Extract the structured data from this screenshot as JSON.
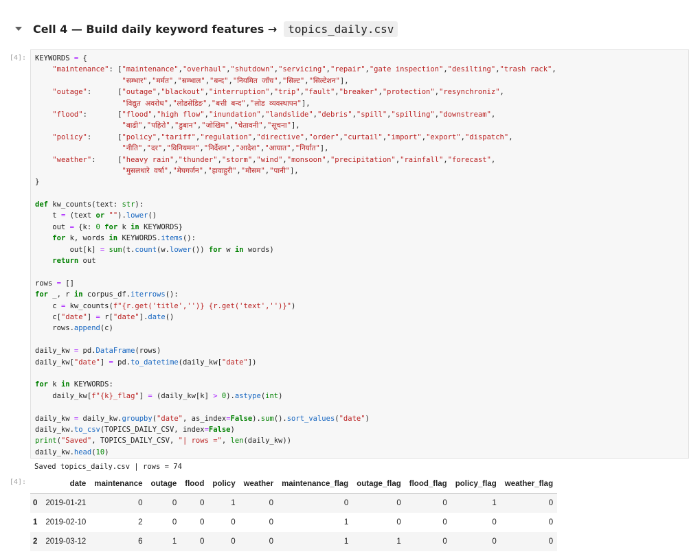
{
  "cell_heading": {
    "text": "Cell 4 — Build daily keyword features →",
    "code": "topics_daily.csv"
  },
  "code_prompt": "[4]:",
  "code_lines": [
    "KEYWORDS = {",
    "    \"maintenance\": [\"maintenance\",\"overhaul\",\"shutdown\",\"servicing\",\"repair\",\"gate inspection\",\"desilting\",\"trash rack\",",
    "                    \"सम्भार\",\"मर्मत\",\"सम्भाल\",\"बन्द\",\"नियमित जाँच\",\"सिल्ट\",\"सिल्टेशन\"],",
    "    \"outage\":      [\"outage\",\"blackout\",\"interruption\",\"trip\",\"fault\",\"breaker\",\"protection\",\"resynchroniz\",",
    "                    \"विद्युत अवरोध\",\"लोडसेडिङ\",\"बत्ती बन्द\",\"लोड व्यवस्थापन\"],",
    "    \"flood\":       [\"flood\",\"high flow\",\"inundation\",\"landslide\",\"debris\",\"spill\",\"spilling\",\"downstream\",",
    "                    \"बाढी\",\"पहिरो\",\"डुबान\",\"जोखिम\",\"चेतावनी\",\"सूचना\"],",
    "    \"policy\":      [\"policy\",\"tariff\",\"regulation\",\"directive\",\"order\",\"curtail\",\"import\",\"export\",\"dispatch\",",
    "                    \"नीति\",\"दर\",\"विनियमन\",\"निर्देशन\",\"आदेश\",\"आयात\",\"निर्यात\"],",
    "    \"weather\":     [\"heavy rain\",\"thunder\",\"storm\",\"wind\",\"monsoon\",\"precipitation\",\"rainfall\",\"forecast\",",
    "                    \"मुसलधारे वर्षा\",\"मेघगर्जन\",\"हावाहुरी\",\"मौसम\",\"पानी\"],",
    "}",
    "",
    "def kw_counts(text: str):",
    "    t = (text or \"\").lower()",
    "    out = {k: 0 for k in KEYWORDS}",
    "    for k, words in KEYWORDS.items():",
    "        out[k] = sum(t.count(w.lower()) for w in words)",
    "    return out",
    "",
    "rows = []",
    "for _, r in corpus_df.iterrows():",
    "    c = kw_counts(f\"{r.get('title','')} {r.get('text','')}\")",
    "    c[\"date\"] = r[\"date\"].date()",
    "    rows.append(c)",
    "",
    "daily_kw = pd.DataFrame(rows)",
    "daily_kw[\"date\"] = pd.to_datetime(daily_kw[\"date\"])",
    "",
    "for k in KEYWORDS:",
    "    daily_kw[f\"{k}_flag\"] = (daily_kw[k] > 0).astype(int)",
    "",
    "daily_kw = daily_kw.groupby(\"date\", as_index=False).sum().sort_values(\"date\")",
    "daily_kw.to_csv(TOPICS_DAILY_CSV, index=False)",
    "print(\"Saved\", TOPICS_DAILY_CSV, \"| rows =\", len(daily_kw))",
    "daily_kw.head(10)"
  ],
  "stdout": "Saved topics_daily.csv | rows = 74",
  "output_prompt": "[4]:",
  "table": {
    "columns": [
      "",
      "date",
      "maintenance",
      "outage",
      "flood",
      "policy",
      "weather",
      "maintenance_flag",
      "outage_flag",
      "flood_flag",
      "policy_flag",
      "weather_flag"
    ],
    "rows": [
      [
        "0",
        "2019-01-21",
        "0",
        "0",
        "0",
        "1",
        "0",
        "0",
        "0",
        "0",
        "1",
        "0"
      ],
      [
        "1",
        "2019-02-10",
        "2",
        "0",
        "0",
        "0",
        "0",
        "1",
        "0",
        "0",
        "0",
        "0"
      ],
      [
        "2",
        "2019-03-12",
        "6",
        "1",
        "0",
        "0",
        "0",
        "1",
        "1",
        "0",
        "0",
        "0"
      ]
    ]
  },
  "colors": {
    "keyword": "#008000",
    "string": "#ba2121",
    "number": "#008800",
    "operator": "#aa22ff",
    "attribute": "#1565c0"
  }
}
